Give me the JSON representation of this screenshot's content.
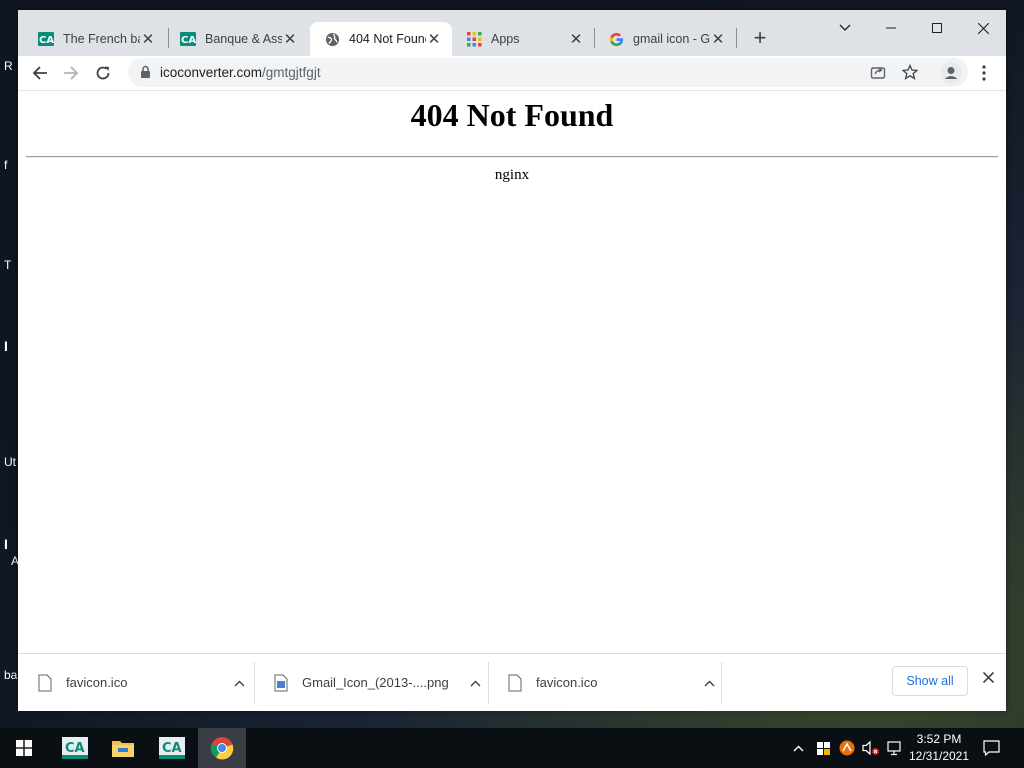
{
  "desktop": {
    "fragments": [
      "R",
      "f",
      "T",
      "I",
      "Ut",
      "I",
      "A",
      "ba"
    ]
  },
  "tabs": [
    {
      "title": "The French ba",
      "favicon": "credit-agricole-logo",
      "active": false
    },
    {
      "title": "Banque & Ass",
      "favicon": "credit-agricole-logo",
      "active": false
    },
    {
      "title": "404 Not Found",
      "favicon": "globe-icon",
      "active": true
    },
    {
      "title": "Apps",
      "favicon": "apps-grid-icon",
      "active": false
    },
    {
      "title": "gmail icon - G",
      "favicon": "google-icon",
      "active": false
    }
  ],
  "toolbar": {
    "url_host": "icoconverter.com",
    "url_path": "/gmtgjtfgjt"
  },
  "page": {
    "heading": "404 Not Found",
    "server": "nginx"
  },
  "downloads": {
    "items": [
      {
        "name": "favicon.ico",
        "type": "file-icon"
      },
      {
        "name": "Gmail_Icon_(2013-....png",
        "type": "image-file-icon"
      },
      {
        "name": "favicon.ico",
        "type": "file-icon"
      }
    ],
    "show_all": "Show all"
  },
  "taskbar": {
    "time": "3:52 PM",
    "date": "12/31/2021"
  },
  "colors": {
    "accent": "#1a73e8",
    "tabstrip": "#dee1e6",
    "taskbar": "#0a0f14"
  }
}
